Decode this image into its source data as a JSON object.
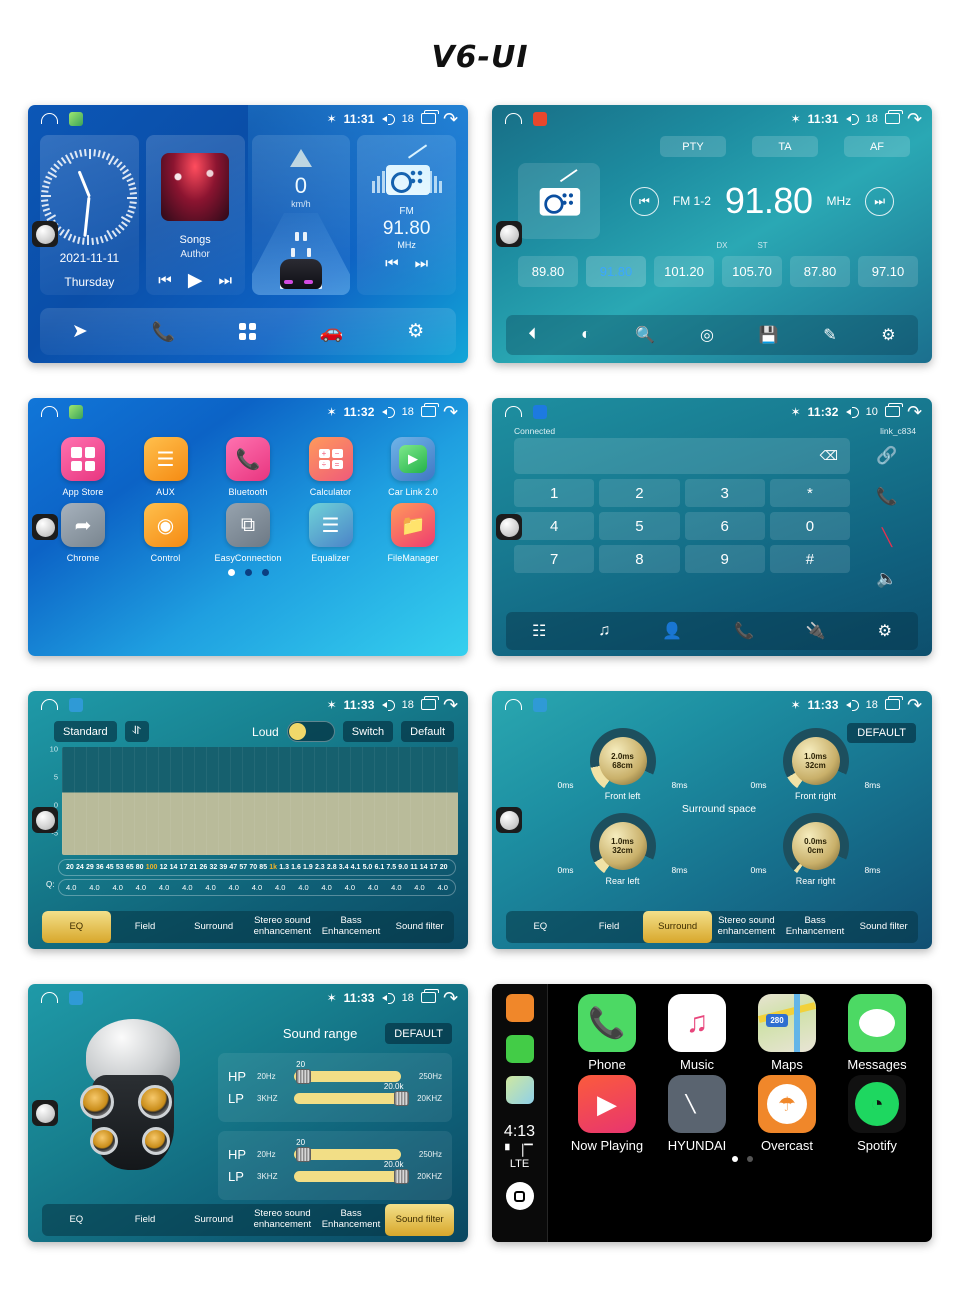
{
  "title": "V6-UI",
  "statusbar": {
    "bluetooth_icon": "bluetooth-icon",
    "time_1131": "11:31",
    "time_1132": "11:32",
    "time_1133": "11:33",
    "volume_18": "18",
    "volume_10": "10"
  },
  "home": {
    "clock_card": {
      "date": "2021-11-11",
      "weekday": "Thursday"
    },
    "music_card": {
      "title": "Songs",
      "artist": "Author"
    },
    "nav_card": {
      "speed": "0",
      "unit": "km/h"
    },
    "radio_card": {
      "band": "FM",
      "frequency": "91.80",
      "unit": "MHz"
    },
    "dock": [
      {
        "name": "navigation-icon",
        "glyph": "➤"
      },
      {
        "name": "phone-icon",
        "glyph": "✆"
      },
      {
        "name": "apps-icon",
        "glyph": ""
      },
      {
        "name": "carplay-icon",
        "glyph": ""
      },
      {
        "name": "settings-icon",
        "glyph": "⚙"
      }
    ]
  },
  "radio": {
    "buttons": [
      "PTY",
      "TA",
      "AF"
    ],
    "band": "FM 1-2",
    "frequency": "91.80",
    "unit": "MHz",
    "dx": "DX",
    "st": "ST",
    "presets": [
      {
        "value": "89.80",
        "active": false
      },
      {
        "value": "91.80",
        "active": true
      },
      {
        "value": "101.20",
        "active": false
      },
      {
        "value": "105.70",
        "active": false
      },
      {
        "value": "87.80",
        "active": false
      },
      {
        "value": "97.10",
        "active": false
      }
    ],
    "dock": [
      "band-icon",
      "stereo-icon",
      "search-icon",
      "location-icon",
      "save-icon",
      "edit-icon",
      "settings-icon"
    ]
  },
  "apps": {
    "row1": [
      {
        "label": "App Store",
        "icon": "grid-icon",
        "color": "#f0519a"
      },
      {
        "label": "AUX",
        "icon": "sliders-icon",
        "color": "#f8a32c"
      },
      {
        "label": "Bluetooth",
        "icon": "phone-icon",
        "color": "#f0519a"
      },
      {
        "label": "Calculator",
        "icon": "calculator-icon",
        "color": "#f4713f"
      },
      {
        "label": "Car Link 2.0",
        "icon": "play-circle-icon",
        "color": "#4d7fc4"
      }
    ],
    "row2": [
      {
        "label": "Chrome",
        "icon": "compass-icon",
        "color": "#8e9aa6"
      },
      {
        "label": "Control",
        "icon": "steering-wheel-icon",
        "color": "#f8a32c"
      },
      {
        "label": "EasyConnection",
        "icon": "screen-share-icon",
        "color": "#7e8a97"
      },
      {
        "label": "Equalizer",
        "icon": "equalizer-icon",
        "color": "#55b4c4"
      },
      {
        "label": "FileManager",
        "icon": "folder-icon",
        "color": "#ef476f"
      }
    ],
    "page_dots": 3,
    "active_dot": 0
  },
  "bluetooth": {
    "status": "Connected",
    "device": "link_c834",
    "input_value": "",
    "keys": [
      "1",
      "2",
      "3",
      "*",
      "4",
      "5",
      "6",
      "0",
      "7",
      "8",
      "9",
      "#"
    ],
    "side_actions": [
      "link-icon",
      "call-icon",
      "hangup-icon",
      "speaker-icon"
    ],
    "dock": [
      "dialpad-icon",
      "music-icon",
      "contacts-icon",
      "call-log-icon",
      "sync-icon",
      "settings-icon"
    ]
  },
  "eq": {
    "preset": "Standard",
    "dropdown_icon": "chevron-down-icon",
    "loud_label": "Loud",
    "loud_on": true,
    "switch_label": "Switch",
    "default_label": "Default",
    "y_ticks": [
      "10",
      "5",
      "0",
      "-5"
    ],
    "frequencies": [
      "20",
      "24",
      "29",
      "36",
      "45",
      "53",
      "65",
      "80",
      "100",
      "12",
      "14",
      "17",
      "21",
      "26",
      "32",
      "39",
      "47",
      "57",
      "70",
      "85",
      "1k",
      "1.3",
      "1.6",
      "1.9",
      "2.3",
      "2.8",
      "3.4",
      "4.1",
      "5.0",
      "6.1",
      "7.5",
      "9.0",
      "11",
      "14",
      "17",
      "20"
    ],
    "highlight_indices": [
      8,
      20
    ],
    "q_label": "Q:",
    "q_values": [
      "4.0",
      "4.0",
      "4.0",
      "4.0",
      "4.0",
      "4.0",
      "4.0",
      "4.0",
      "4.0",
      "4.0",
      "4.0",
      "4.0",
      "4.0",
      "4.0",
      "4.0",
      "4.0",
      "4.0"
    ],
    "tabs": [
      "EQ",
      "Field",
      "Surround",
      "Stereo sound enhancement",
      "Bass Enhancement",
      "Sound filter"
    ],
    "active_tab": 0
  },
  "surround": {
    "default_label": "DEFAULT",
    "title": "Surround space",
    "knobs": [
      {
        "name": "Front left",
        "ms": "2.0ms",
        "cm": "68cm",
        "min": "0ms",
        "max": "8ms"
      },
      {
        "name": "Front right",
        "ms": "1.0ms",
        "cm": "32cm",
        "min": "0ms",
        "max": "8ms"
      },
      {
        "name": "Rear left",
        "ms": "1.0ms",
        "cm": "32cm",
        "min": "0ms",
        "max": "8ms"
      },
      {
        "name": "Rear right",
        "ms": "0.0ms",
        "cm": "0cm",
        "min": "0ms",
        "max": "8ms"
      }
    ],
    "tabs": [
      "EQ",
      "Field",
      "Surround",
      "Stereo sound enhancement",
      "Bass Enhancement",
      "Sound filter"
    ],
    "active_tab": 2
  },
  "soundfilter": {
    "title": "Sound range",
    "default_label": "DEFAULT",
    "groups": [
      {
        "rows": [
          {
            "name": "HP",
            "unit": "20Hz",
            "value": "20",
            "max": "250Hz",
            "pos": 2
          },
          {
            "name": "LP",
            "unit": "3KHZ",
            "value": "20.0k",
            "max": "20KHZ",
            "pos": 95
          }
        ]
      },
      {
        "rows": [
          {
            "name": "HP",
            "unit": "20Hz",
            "value": "20",
            "max": "250Hz",
            "pos": 2
          },
          {
            "name": "LP",
            "unit": "3KHZ",
            "value": "20.0k",
            "max": "20KHZ",
            "pos": 95
          }
        ]
      }
    ],
    "tabs": [
      "EQ",
      "Field",
      "Surround",
      "Stereo sound enhancement",
      "Bass Enhancement",
      "Sound filter"
    ],
    "active_tab": 5
  },
  "carplay": {
    "time": "4:13",
    "carrier": "LTE",
    "signal_icon": "signal-bars-icon",
    "home_icon": "carplay-home-icon",
    "row1": [
      {
        "label": "Phone",
        "icon": "phone-icon"
      },
      {
        "label": "Music",
        "icon": "music-note-icon"
      },
      {
        "label": "Maps",
        "icon": "maps-icon",
        "shield": "280"
      },
      {
        "label": "Messages",
        "icon": "messages-icon"
      }
    ],
    "row2": [
      {
        "label": "Now Playing",
        "icon": "now-playing-icon"
      },
      {
        "label": "HYUNDAI",
        "icon": "hyundai-icon"
      },
      {
        "label": "Overcast",
        "icon": "overcast-icon"
      },
      {
        "label": "Spotify",
        "icon": "spotify-icon"
      }
    ],
    "page_dots": 2,
    "active_dot": 0
  }
}
